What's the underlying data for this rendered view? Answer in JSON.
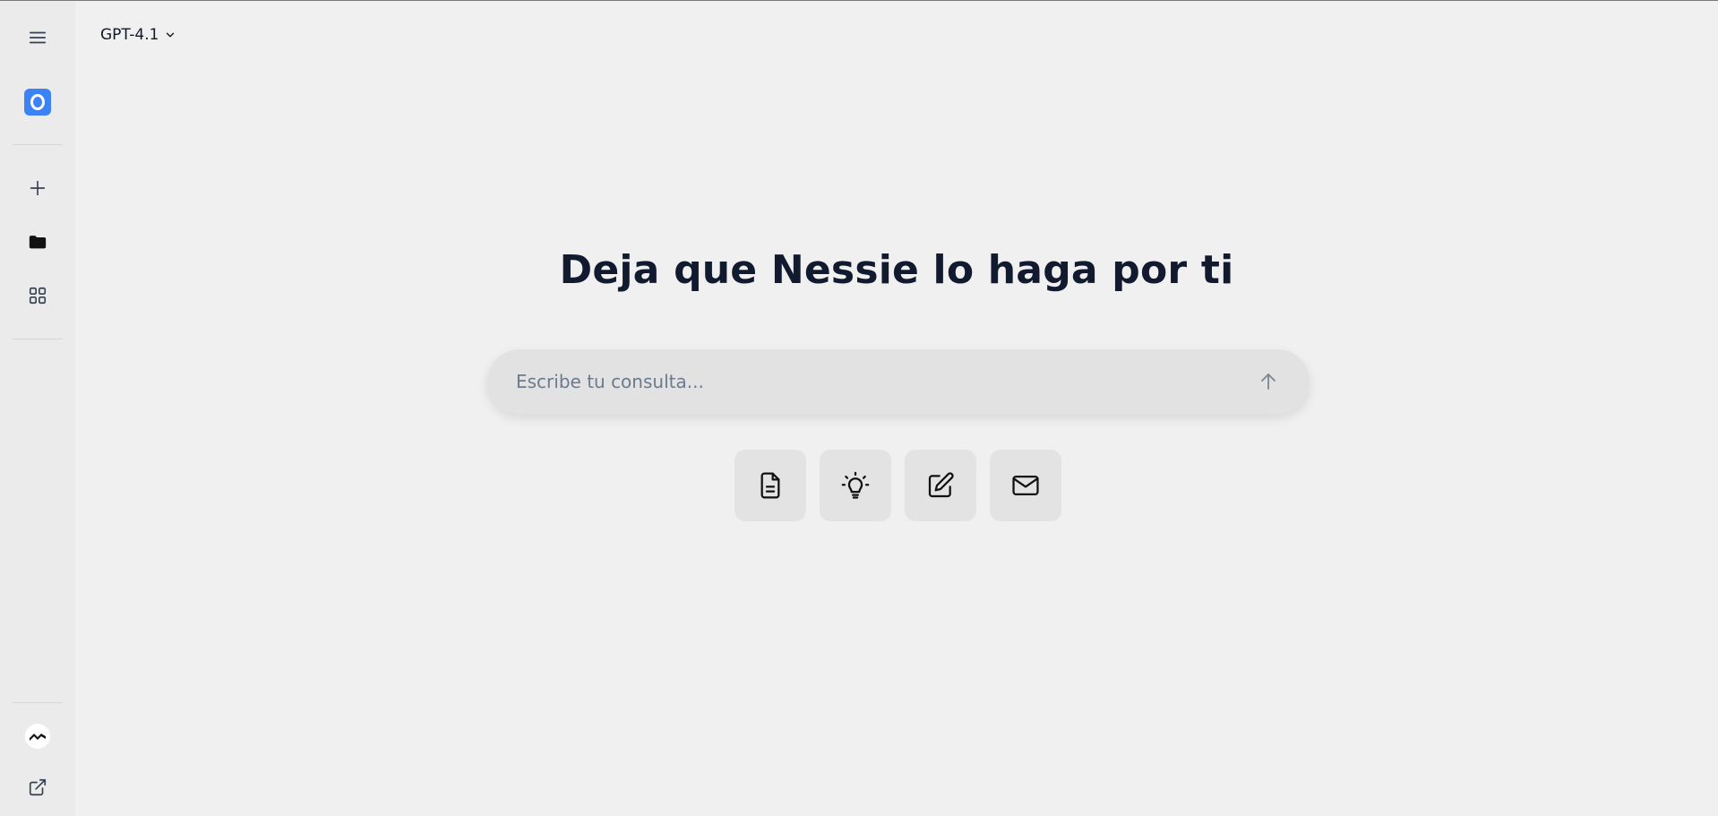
{
  "header": {
    "model_label": "GPT-4.1"
  },
  "main": {
    "headline": "Deja que Nessie lo haga por ti",
    "search": {
      "placeholder": "Escribe tu consulta...",
      "value": ""
    },
    "quick_actions": [
      {
        "icon": "document-icon"
      },
      {
        "icon": "lightbulb-icon"
      },
      {
        "icon": "edit-icon"
      },
      {
        "icon": "mail-icon"
      }
    ]
  },
  "sidebar": {
    "items": [
      {
        "icon": "menu-icon"
      },
      {
        "icon": "brand-logo"
      },
      {
        "icon": "plus-icon"
      },
      {
        "icon": "folder-icon"
      },
      {
        "icon": "grid-icon"
      },
      {
        "icon": "user-avatar"
      },
      {
        "icon": "external-link-icon"
      }
    ]
  },
  "colors": {
    "background": "#f0f0f0",
    "sidebar": "#ebebeb",
    "accent": "#3b82f6",
    "headline": "#111a2e",
    "input_bg": "#e2e2e2",
    "placeholder": "#6b7a8d"
  }
}
